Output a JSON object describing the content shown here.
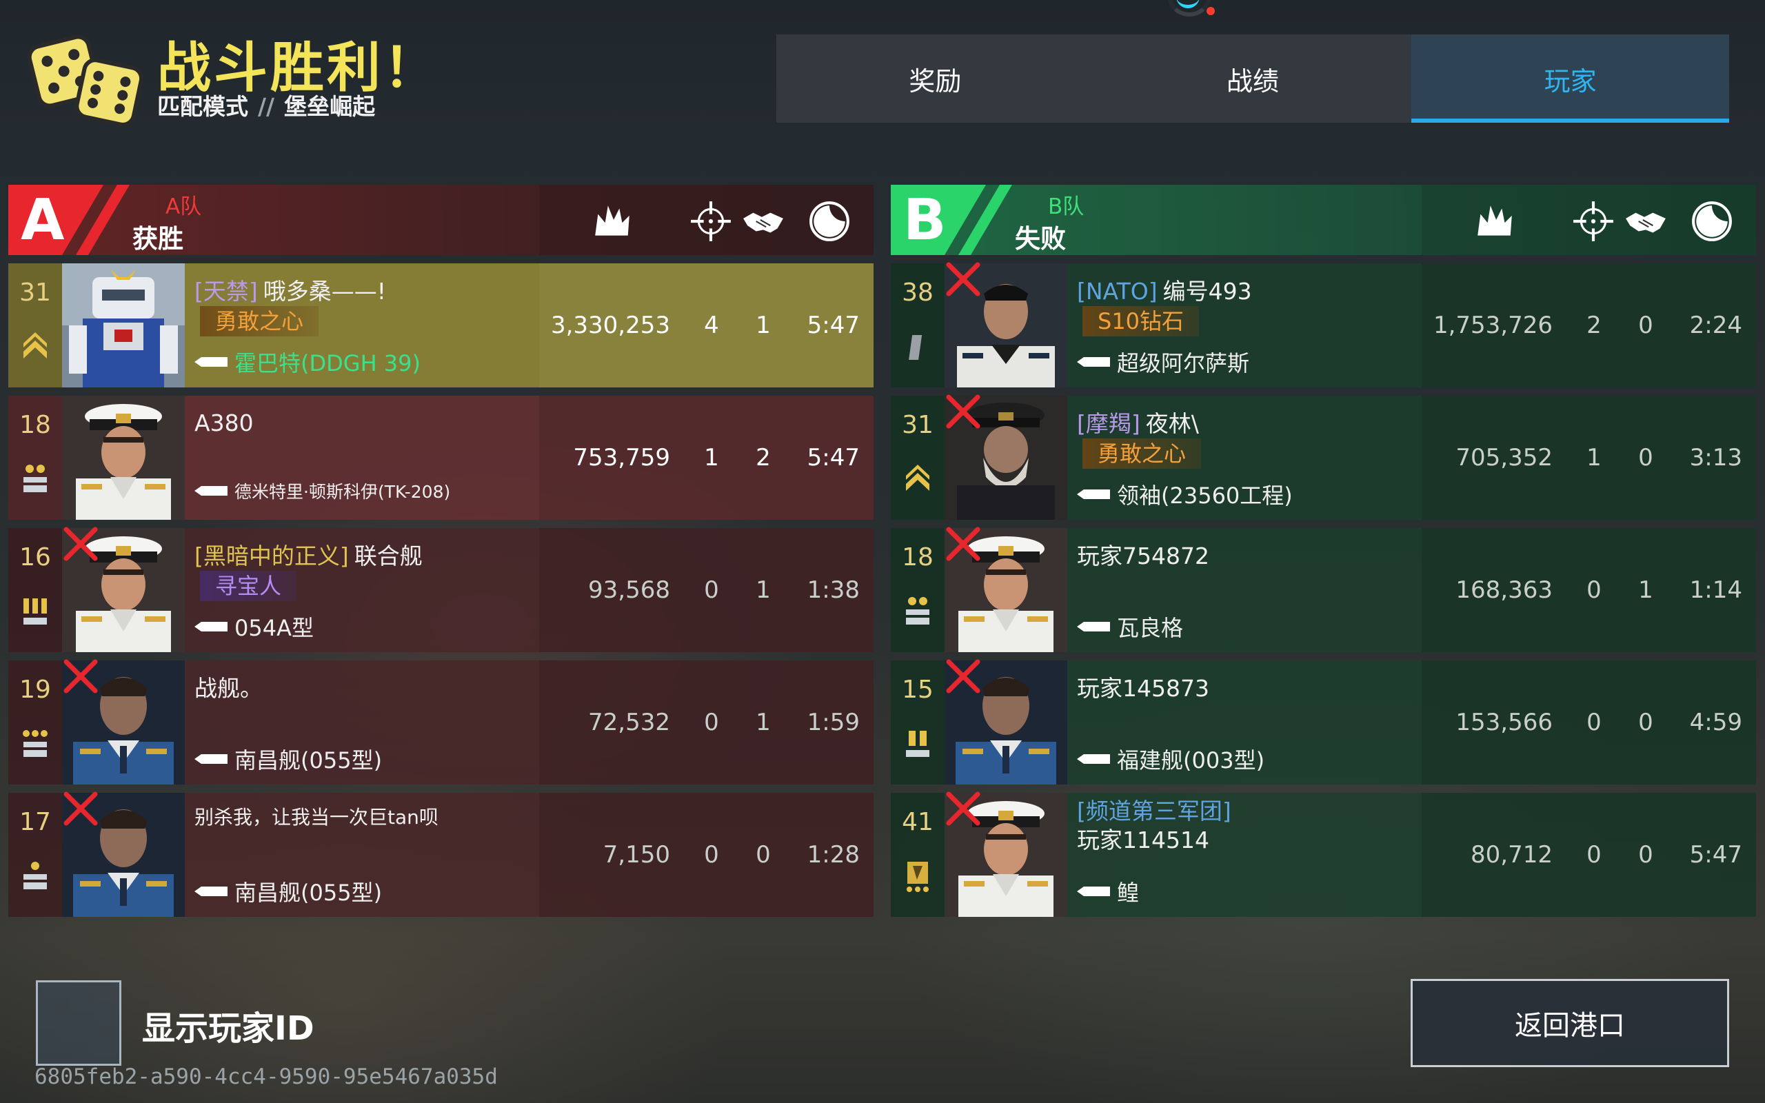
{
  "header": {
    "title": "战斗胜利！",
    "mode": "匹配模式",
    "separator": "//",
    "map": "堡垒崛起"
  },
  "tabs": [
    {
      "label": "奖励",
      "active": false
    },
    {
      "label": "战绩",
      "active": false
    },
    {
      "label": "玩家",
      "active": true
    }
  ],
  "columns_icons": [
    "damage-icon",
    "kills-crosshair-icon",
    "assists-handshake-icon",
    "time-clock-icon"
  ],
  "team_a": {
    "letter": "A",
    "name": "A队",
    "result": "获胜",
    "color": "#e8262e",
    "players": [
      {
        "level": "31",
        "rank_icon": "chevron-rank-icon",
        "dead": false,
        "highlight": true,
        "clan": "[天禁]",
        "name": "哦多桑——!",
        "badge": "勇敢之心",
        "badge_color": "orange",
        "ship": "霍巴特(DDGH 39)",
        "ship_color": "green",
        "score": "3,330,253",
        "kills": "4",
        "assists": "1",
        "time": "5:47",
        "portrait": "mech"
      },
      {
        "level": "18",
        "rank_icon": "two-star-rank-icon",
        "dead": false,
        "highlight": false,
        "clan": "",
        "name": "A380",
        "badge": "",
        "badge_color": "",
        "ship": "德米特里·顿斯科伊(TK-208)",
        "ship_color": "small",
        "score": "753,759",
        "kills": "1",
        "assists": "2",
        "time": "5:47",
        "portrait": "officer-white"
      },
      {
        "level": "16",
        "rank_icon": "three-bar-rank-icon",
        "dead": true,
        "highlight": false,
        "clan": "[黑暗中的正义]",
        "name": "联合舰",
        "badge": "寻宝人",
        "badge_color": "purple",
        "ship": "054A型",
        "ship_color": "",
        "score": "93,568",
        "kills": "0",
        "assists": "1",
        "time": "1:38",
        "portrait": "officer-white"
      },
      {
        "level": "19",
        "rank_icon": "three-star-rank-icon",
        "dead": true,
        "highlight": false,
        "clan": "",
        "name": "战舰。",
        "badge": "",
        "badge_color": "",
        "ship": "南昌舰(055型)",
        "ship_color": "",
        "score": "72,532",
        "kills": "0",
        "assists": "1",
        "time": "1:59",
        "portrait": "officer-blue"
      },
      {
        "level": "17",
        "rank_icon": "one-star-rank-icon",
        "dead": true,
        "highlight": false,
        "clan": "",
        "name": "别杀我，让我当一次巨tan呗",
        "badge": "",
        "badge_color": "",
        "ship": "南昌舰(055型)",
        "ship_color": "",
        "score": "7,150",
        "kills": "0",
        "assists": "0",
        "time": "1:28",
        "portrait": "officer-blue"
      }
    ]
  },
  "team_b": {
    "letter": "B",
    "name": "B队",
    "result": "失败",
    "color": "#2ad46a",
    "players": [
      {
        "level": "38",
        "rank_icon": "bar-rank-icon",
        "dead": true,
        "highlight": false,
        "clan": "[NATO]",
        "clan_color": "blue",
        "name": "编号493",
        "badge": "S10钻石",
        "badge_color": "orange",
        "ship": "超级阿尔萨斯",
        "ship_color": "",
        "score": "1,753,726",
        "kills": "2",
        "assists": "0",
        "time": "2:24",
        "portrait": "officer-navy"
      },
      {
        "level": "31",
        "rank_icon": "chevron-rank-icon",
        "dead": true,
        "highlight": false,
        "clan": "[摩羯]",
        "name": "夜林\\",
        "badge": "勇敢之心",
        "badge_color": "orange",
        "ship": "领袖(23560工程)",
        "ship_color": "",
        "score": "705,352",
        "kills": "1",
        "assists": "0",
        "time": "3:13",
        "portrait": "old-captain"
      },
      {
        "level": "18",
        "rank_icon": "two-star-rank-icon",
        "dead": true,
        "highlight": false,
        "clan": "",
        "name": "玩家754872",
        "badge": "",
        "badge_color": "",
        "ship": "瓦良格",
        "ship_color": "",
        "score": "168,363",
        "kills": "0",
        "assists": "1",
        "time": "1:14",
        "portrait": "officer-white"
      },
      {
        "level": "15",
        "rank_icon": "two-bar-rank-icon",
        "dead": true,
        "highlight": false,
        "clan": "",
        "name": "玩家145873",
        "badge": "",
        "badge_color": "",
        "ship": "福建舰(003型)",
        "ship_color": "",
        "score": "153,566",
        "kills": "0",
        "assists": "0",
        "time": "4:59",
        "portrait": "officer-blue"
      },
      {
        "level": "41",
        "rank_icon": "gold-rank-icon",
        "dead": true,
        "highlight": false,
        "clan": "[频道第三军团]",
        "clan_color": "blue",
        "name": "玩家114514",
        "badge": "",
        "badge_color": "",
        "ship": "鳇",
        "ship_color": "",
        "score": "80,712",
        "kills": "0",
        "assists": "0",
        "time": "5:47",
        "portrait": "officer-white"
      }
    ]
  },
  "footer": {
    "show_id_label": "显示玩家ID",
    "show_id_checked": false,
    "player_uuid": "6805feb2-a590-4cc4-9590-95e5467a035d",
    "return_button": "返回港口"
  }
}
